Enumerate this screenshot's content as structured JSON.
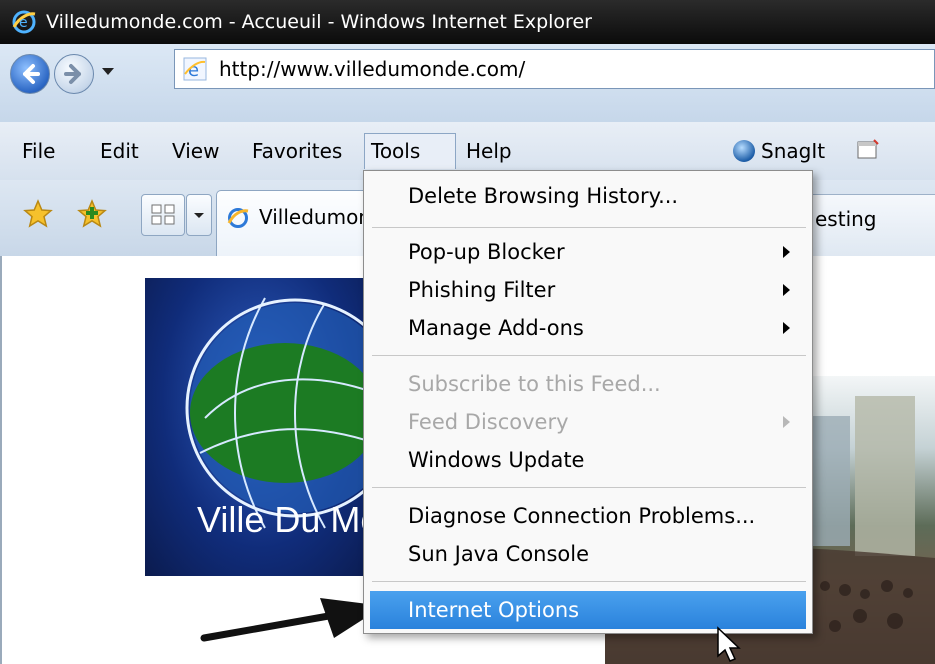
{
  "window": {
    "title": "Villedumonde.com - Accueuil - Windows Internet Explorer"
  },
  "address": {
    "url": "http://www.villedumonde.com/"
  },
  "menubar": {
    "items": [
      "File",
      "Edit",
      "View",
      "Favorites",
      "Tools",
      "Help"
    ],
    "active": "Tools",
    "snagit_label": "SnagIt"
  },
  "tabs": {
    "active_tab_title": "Villedumonde.com",
    "second_tab_title": "esting"
  },
  "page": {
    "logo_text": "Ville Du Monde"
  },
  "tools_menu": {
    "items": [
      {
        "label": "Delete Browsing History...",
        "enabled": true,
        "submenu": false
      },
      {
        "label": "Pop-up Blocker",
        "enabled": true,
        "submenu": true
      },
      {
        "label": "Phishing Filter",
        "enabled": true,
        "submenu": true
      },
      {
        "label": "Manage Add-ons",
        "enabled": true,
        "submenu": true
      },
      {
        "label": "Subscribe to this Feed...",
        "enabled": false,
        "submenu": false
      },
      {
        "label": "Feed Discovery",
        "enabled": false,
        "submenu": true
      },
      {
        "label": "Windows Update",
        "enabled": true,
        "submenu": false
      },
      {
        "label": "Diagnose Connection Problems...",
        "enabled": true,
        "submenu": false
      },
      {
        "label": "Sun Java Console",
        "enabled": true,
        "submenu": false
      },
      {
        "label": "Internet Options",
        "enabled": true,
        "submenu": false,
        "highlighted": true
      }
    ]
  },
  "colors": {
    "titlebar": "#111111",
    "highlight": "#3a8fe6",
    "menu_bg": "#f9f9f9"
  },
  "icons": [
    "ie-logo-icon",
    "back-arrow-icon",
    "forward-arrow-icon",
    "favorites-star-icon",
    "add-favorites-icon",
    "quick-tabs-icon",
    "snagit-icon",
    "mouse-pointer-icon",
    "annotation-arrow-icon"
  ]
}
